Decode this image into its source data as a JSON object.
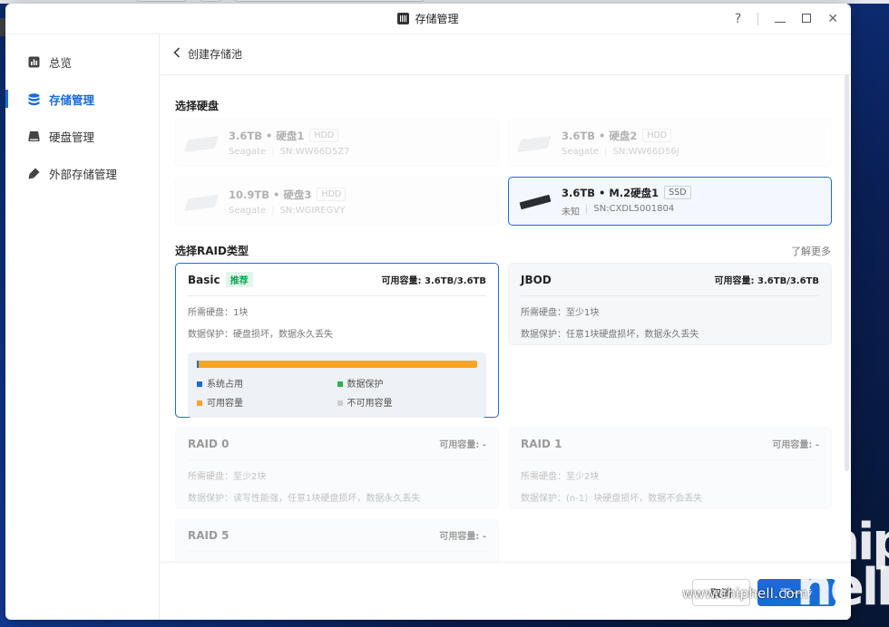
{
  "app": {
    "title": "存储管理"
  },
  "window_controls": {
    "help": "?"
  },
  "sidebar": {
    "items": [
      {
        "label": "总览",
        "icon": "chart-icon",
        "active": false
      },
      {
        "label": "存储管理",
        "icon": "database-icon",
        "active": true
      },
      {
        "label": "硬盘管理",
        "icon": "disk-icon",
        "active": false
      },
      {
        "label": "外部存储管理",
        "icon": "usb-icon",
        "active": false
      }
    ]
  },
  "breadcrumb": {
    "label": "创建存储池"
  },
  "disk_section": {
    "title": "选择硬盘"
  },
  "disks": [
    {
      "title": "3.6TB • 硬盘1",
      "type": "HDD",
      "brand": "Seagate",
      "sn": "SN:WW66D5Z7",
      "state": "disabled"
    },
    {
      "title": "3.6TB • 硬盘2",
      "type": "HDD",
      "brand": "Seagate",
      "sn": "SN:WW66D56J",
      "state": "disabled"
    },
    {
      "title": "10.9TB • 硬盘3",
      "type": "HDD",
      "brand": "Seagate",
      "sn": "SN:WGIREGVY",
      "state": "disabled"
    },
    {
      "title": "3.6TB • M.2硬盘1",
      "type": "SSD",
      "brand": "未知",
      "sn": "SN:CXDL5001804",
      "state": "selected"
    }
  ],
  "raid_section": {
    "title": "选择RAID类型",
    "more": "了解更多"
  },
  "raids": [
    {
      "name": "Basic",
      "badge": "推荐",
      "capacity": "可用容量: 3.6TB/3.6TB",
      "required": "所需硬盘：1块",
      "protection": "数据保护：硬盘损坏，数据永久丢失",
      "state": "selected"
    },
    {
      "name": "JBOD",
      "capacity": "可用容量: 3.6TB/3.6TB",
      "required": "所需硬盘：至少1块",
      "protection": "数据保护：任意1块硬盘损坏，数据永久丢失",
      "state": "normal"
    },
    {
      "name": "RAID 0",
      "capacity": "可用容量: -",
      "required": "所需硬盘：至少2块",
      "protection": "数据保护：读写性能强，任意1块硬盘损坏，数据永久丢失",
      "state": "disabled"
    },
    {
      "name": "RAID 1",
      "capacity": "可用容量: -",
      "required": "所需硬盘：至少2块",
      "protection": "数据保护：(n-1）块硬盘损坏，数据不会丢失",
      "state": "disabled"
    },
    {
      "name": "RAID 5",
      "capacity": "可用容量: -",
      "required": "",
      "protection": "",
      "state": "disabled"
    }
  ],
  "capacity_legend": {
    "system": "系统占用",
    "protection": "数据保护",
    "available": "可用容量",
    "unavailable": "不可用容量",
    "colors": {
      "system": "#1a6bd9",
      "protection": "#2bb24c",
      "available": "#f5a623",
      "unavailable": "#cccccc"
    },
    "available_fraction": 0.99
  },
  "footer": {
    "cancel": "取消",
    "next": "下一步"
  },
  "watermark": {
    "site": "www.chiphell.com",
    "logo": "chip hell"
  }
}
